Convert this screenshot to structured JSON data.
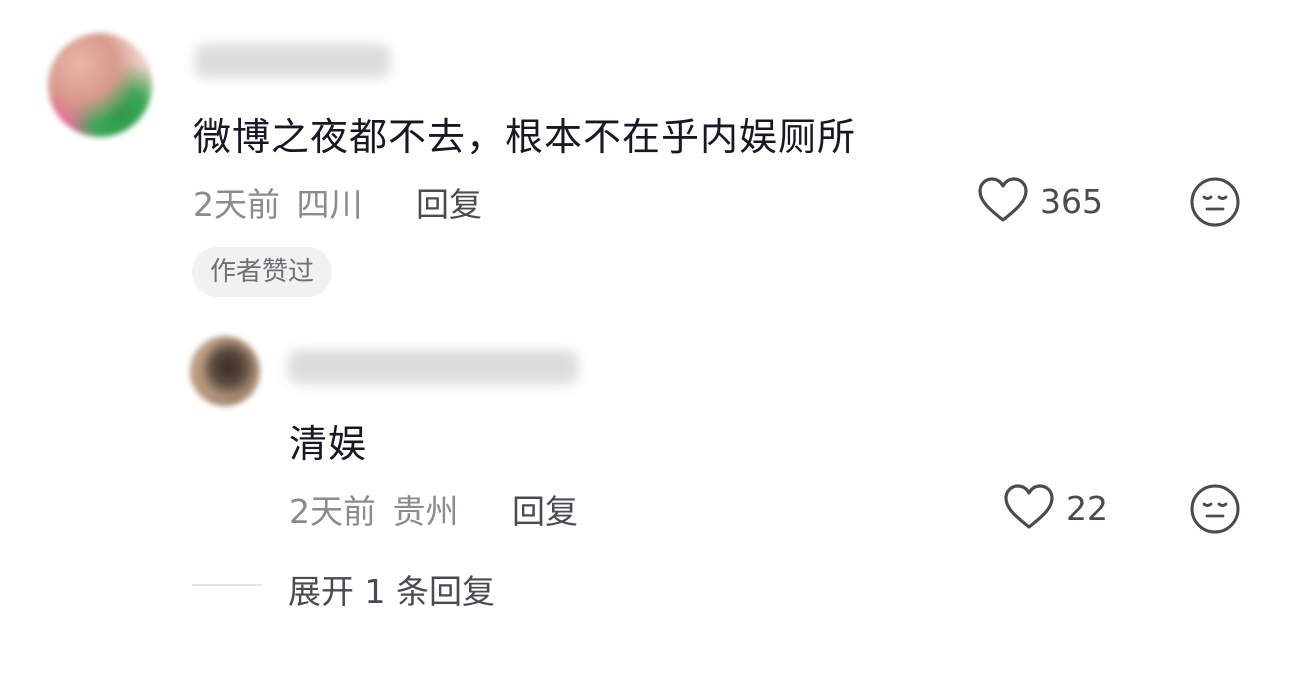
{
  "comment": {
    "text": "微博之夜都不去，根本不在乎内娱厕所",
    "time": "2天前",
    "location": "四川",
    "reply_label": "回复",
    "likes": "365",
    "badge": "作者赞过"
  },
  "reply": {
    "text": "清娱",
    "time": "2天前",
    "location": "贵州",
    "reply_label": "回复",
    "likes": "22"
  },
  "expand_label": "展开 1 条回复",
  "icons": {
    "like": "heart-outline-icon",
    "dislike": "neutral-face-icon"
  },
  "colors": {
    "text_primary": "#161823",
    "text_meta": "#8a8b91",
    "text_action": "#4a4b52",
    "badge_bg": "#f1f1f2"
  }
}
